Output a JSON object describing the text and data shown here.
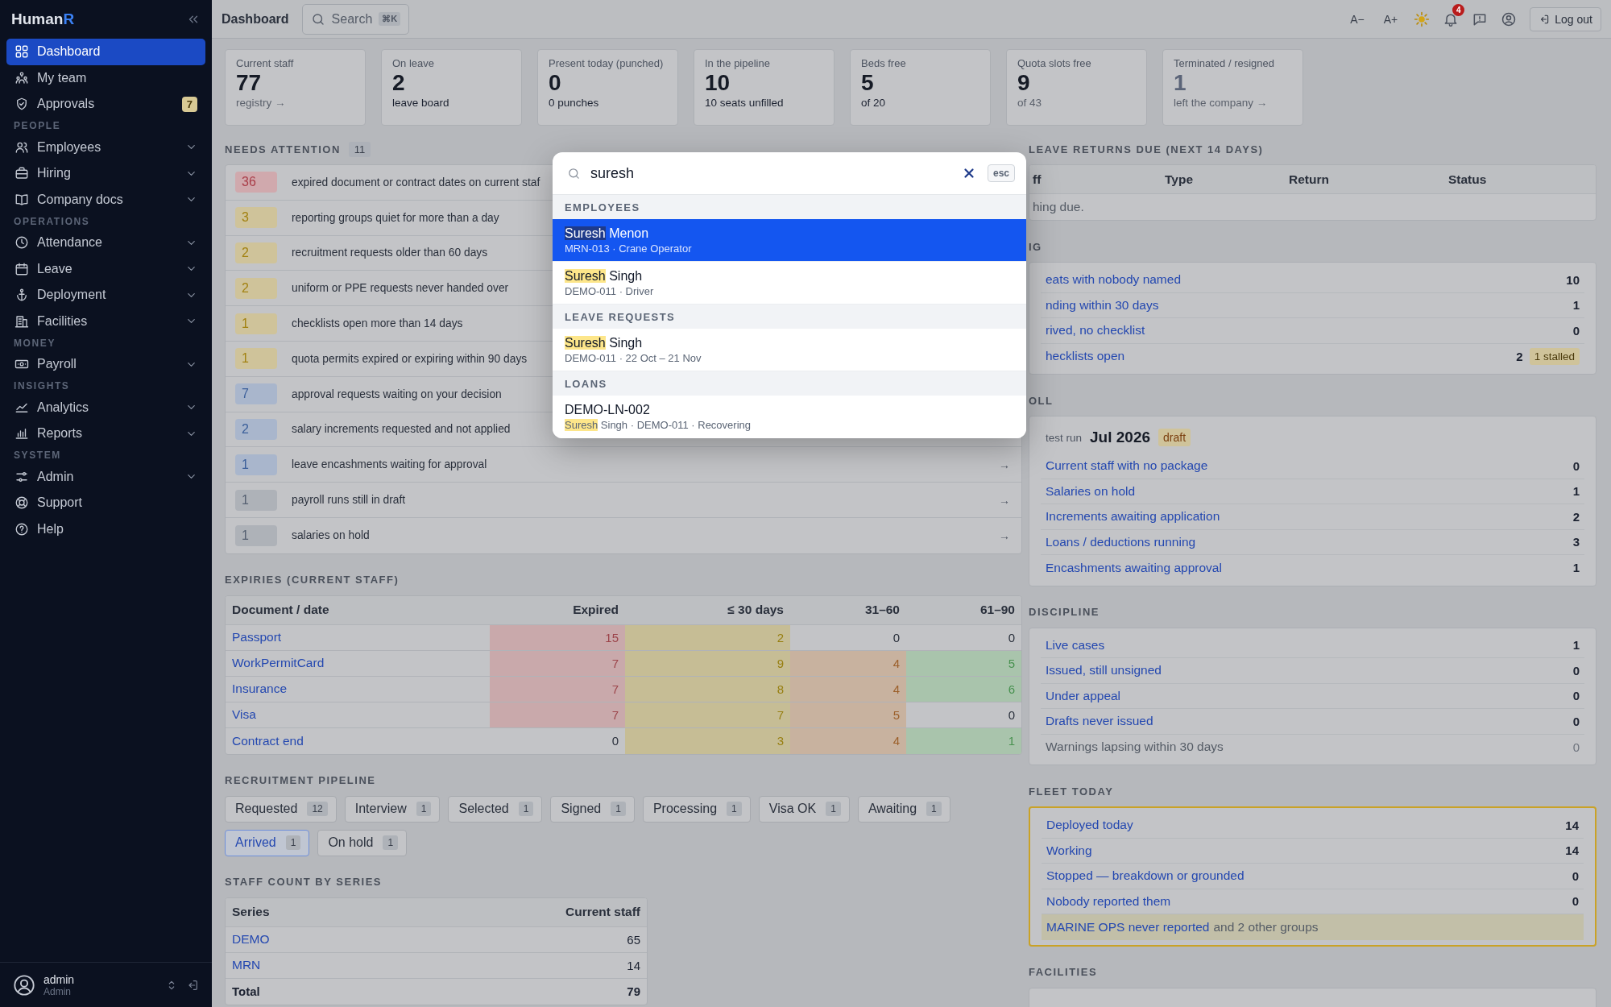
{
  "sidebar": {
    "logo": {
      "text": "Human",
      "accent": "R"
    },
    "sections": [
      {
        "items": [
          {
            "label": "Dashboard",
            "selected": true,
            "expandable": false
          },
          {
            "label": "My team",
            "selected": false,
            "expandable": false
          },
          {
            "label": "Approvals",
            "selected": false,
            "expandable": false,
            "badge": "7"
          }
        ]
      },
      {
        "label": "PEOPLE",
        "items": [
          {
            "label": "Employees",
            "selected": false,
            "expandable": true
          },
          {
            "label": "Hiring",
            "selected": false,
            "expandable": true
          },
          {
            "label": "Company docs",
            "selected": false,
            "expandable": true
          }
        ]
      },
      {
        "label": "OPERATIONS",
        "items": [
          {
            "label": "Attendance",
            "selected": false,
            "expandable": true
          },
          {
            "label": "Leave",
            "selected": false,
            "expandable": true
          },
          {
            "label": "Deployment",
            "selected": false,
            "expandable": true
          },
          {
            "label": "Facilities",
            "selected": false,
            "expandable": true
          }
        ]
      },
      {
        "label": "MONEY",
        "items": [
          {
            "label": "Payroll",
            "selected": false,
            "expandable": true
          }
        ]
      },
      {
        "label": "INSIGHTS",
        "items": [
          {
            "label": "Analytics",
            "selected": false,
            "expandable": true
          },
          {
            "label": "Reports",
            "selected": false,
            "expandable": true
          }
        ]
      },
      {
        "label": "SYSTEM",
        "items": [
          {
            "label": "Admin",
            "selected": false,
            "expandable": true
          },
          {
            "label": "Support",
            "selected": false,
            "expandable": false
          },
          {
            "label": "Help",
            "selected": false,
            "expandable": false
          }
        ]
      }
    ],
    "user": {
      "name": "admin",
      "role": "Admin"
    }
  },
  "topbar": {
    "title": "Dashboard",
    "search": {
      "label": "Search",
      "shortcut": "⌘K"
    },
    "font_smaller": "A−",
    "font_larger": "A+",
    "notifications": "4",
    "logout": "Log out"
  },
  "stats": [
    {
      "label": "Current staff",
      "value": "77",
      "sub": "registry →",
      "value_muted": false,
      "sub_muted": true
    },
    {
      "label": "On leave",
      "value": "2",
      "sub": "leave board",
      "value_muted": false,
      "sub_muted": false
    },
    {
      "label": "Present today (punched)",
      "value": "0",
      "sub": "0 punches",
      "value_muted": false,
      "sub_muted": false
    },
    {
      "label": "In the pipeline",
      "value": "10",
      "sub": "10 seats unfilled",
      "value_muted": false,
      "sub_muted": false
    },
    {
      "label": "Beds free",
      "value": "5",
      "sub": "of 20",
      "value_muted": false,
      "sub_muted": false
    },
    {
      "label": "Quota slots free",
      "value": "9",
      "sub": "of 43",
      "value_muted": false,
      "sub_muted": true
    },
    {
      "label": "Terminated / resigned",
      "value": "1",
      "sub": "left the company →",
      "value_muted": true,
      "sub_muted": true
    }
  ],
  "needs_attention": {
    "title": "NEEDS ATTENTION",
    "count": "11",
    "rows": [
      {
        "count": "36",
        "color": "#d0a9ad",
        "text": "expired document or contract dates on current staf"
      },
      {
        "count": "3",
        "color": "#cfc39a",
        "text": "reporting groups quiet for more than a day"
      },
      {
        "count": "2",
        "color": "#cfc39a",
        "text": "recruitment requests older than 60 days"
      },
      {
        "count": "2",
        "color": "#cfc39a",
        "text": "uniform or PPE requests never handed over"
      },
      {
        "count": "1",
        "color": "#cfc39a",
        "text": "checklists open more than 14 days"
      },
      {
        "count": "1",
        "color": "#cfc39a",
        "text": "quota permits expired or expiring within 90 days"
      },
      {
        "count": "7",
        "color": "#a9b6cc",
        "text": "approval requests waiting on your decision"
      },
      {
        "count": "2",
        "color": "#a9b6cc",
        "text": "salary increments requested and not applied"
      },
      {
        "count": "1",
        "color": "#a9b6cc",
        "text": "leave encashments waiting for approval",
        "arrow": "→"
      },
      {
        "count": "1",
        "color": "#aeb2b8",
        "text": "payroll runs still in draft",
        "arrow": "→"
      },
      {
        "count": "1",
        "color": "#aeb2b8",
        "text": "salaries on hold",
        "arrow": "→"
      }
    ]
  },
  "expiries": {
    "title": "EXPIRIES (CURRENT STAFF)",
    "columns": [
      "Document / date",
      "Expired",
      "≤ 30 days",
      "31–60",
      "61–90"
    ],
    "rows": [
      {
        "cells": [
          {
            "value": "Passport"
          },
          {
            "value": "15",
            "color": "#c9a9ab"
          },
          {
            "value": "2",
            "color": "#c6bd95"
          },
          {
            "value": "0"
          },
          {
            "value": "0"
          }
        ]
      },
      {
        "cells": [
          {
            "value": "WorkPermitCard"
          },
          {
            "value": "7",
            "color": "#c9a9ab"
          },
          {
            "value": "9",
            "color": "#c6bd95"
          },
          {
            "value": "4",
            "color": "#c8b29f"
          },
          {
            "value": "5",
            "color": "#a9c4ac"
          }
        ]
      },
      {
        "cells": [
          {
            "value": "Insurance"
          },
          {
            "value": "7",
            "color": "#c9a9ab"
          },
          {
            "value": "8",
            "color": "#c6bd95"
          },
          {
            "value": "4",
            "color": "#c8b29f"
          },
          {
            "value": "6",
            "color": "#a9c4ac"
          }
        ]
      },
      {
        "cells": [
          {
            "value": "Visa"
          },
          {
            "value": "7",
            "color": "#c9a9ab"
          },
          {
            "value": "7",
            "color": "#c6bd95"
          },
          {
            "value": "5",
            "color": "#c8b29f"
          },
          {
            "value": "0"
          }
        ]
      },
      {
        "cells": [
          {
            "value": "Contract end"
          },
          {
            "value": "0"
          },
          {
            "value": "3",
            "color": "#c6bd95"
          },
          {
            "value": "4",
            "color": "#c8b29f"
          },
          {
            "value": "1",
            "color": "#a9c4ac"
          }
        ]
      }
    ]
  },
  "pipeline": {
    "title": "RECRUITMENT PIPELINE",
    "stages": [
      {
        "label": "Requested",
        "count": "12",
        "selected": false
      },
      {
        "label": "Interview",
        "count": "1",
        "selected": false
      },
      {
        "label": "Selected",
        "count": "1",
        "selected": false
      },
      {
        "label": "Signed",
        "count": "1",
        "selected": false
      },
      {
        "label": "Processing",
        "count": "1",
        "selected": false
      },
      {
        "label": "Visa OK",
        "count": "1",
        "selected": false
      },
      {
        "label": "Awaiting",
        "count": "1",
        "selected": false
      },
      {
        "label": "Arrived",
        "count": "1",
        "selected": true
      },
      {
        "label": "On hold",
        "count": "1",
        "selected": false
      }
    ]
  },
  "staff_by_series": {
    "title": "STAFF COUNT BY SERIES",
    "columns": [
      "Series",
      "Current staff"
    ],
    "rows": [
      {
        "name": "DEMO",
        "value": "65"
      },
      {
        "name": "MRN",
        "value": "14"
      }
    ],
    "total": {
      "label": "Total",
      "value": "79"
    }
  },
  "leave_returns": {
    "title": "LEAVE RETURNS DUE (NEXT 14 DAYS)",
    "columns": [
      "ff",
      "Type",
      "Return",
      "Status"
    ],
    "empty": "hing due."
  },
  "hiring": {
    "title": "IG",
    "rows": [
      {
        "label": "eats with nobody named",
        "value": "10",
        "muted": false
      },
      {
        "label": "nding within 30 days",
        "value": "1",
        "muted": false
      },
      {
        "label": "rived, no checklist",
        "value": "0",
        "muted": false
      },
      {
        "label": "hecklists open",
        "value": "2",
        "muted": false,
        "tag": "1 stalled"
      }
    ]
  },
  "payroll": {
    "title": "OLL",
    "latest_label": "test run",
    "latest_value": "Jul 2026",
    "latest_tag": "draft",
    "rows": [
      {
        "label": "Current staff with no package",
        "value": "0",
        "muted": false
      },
      {
        "label": "Salaries on hold",
        "value": "1",
        "muted": false
      },
      {
        "label": "Increments awaiting application",
        "value": "2",
        "muted": false
      },
      {
        "label": "Loans / deductions running",
        "value": "3",
        "muted": false
      },
      {
        "label": "Encashments awaiting approval",
        "value": "1",
        "muted": false
      }
    ]
  },
  "discipline": {
    "title": "DISCIPLINE",
    "rows": [
      {
        "label": "Live cases",
        "value": "1",
        "muted": false
      },
      {
        "label": "Issued, still unsigned",
        "value": "0",
        "muted": false
      },
      {
        "label": "Under appeal",
        "value": "0",
        "muted": false
      },
      {
        "label": "Drafts never issued",
        "value": "0",
        "muted": false
      },
      {
        "label": "Warnings lapsing within 30 days",
        "value": "0",
        "muted": true
      }
    ]
  },
  "fleet": {
    "title": "FLEET TODAY",
    "alert": true,
    "rows": [
      {
        "label": "Deployed today",
        "value": "14",
        "muted": false
      },
      {
        "label": "Working",
        "value": "14",
        "muted": false
      },
      {
        "label": "Stopped — breakdown or grounded",
        "value": "0",
        "muted": false
      },
      {
        "label": "Nobody reported them",
        "value": "0",
        "muted": false
      }
    ],
    "note": {
      "link": "MARINE OPS never reported",
      "text": "and 2 other groups"
    }
  },
  "facilities": {
    "title": "FACILITIES"
  },
  "popup": {
    "query": "suresh",
    "esc": "esc",
    "groups": [
      {
        "title": "EMPLOYEES",
        "items": [
          {
            "selected": true,
            "title": [
              {
                "text": "Suresh",
                "match": true
              },
              {
                "text": "Menon",
                "match": false
              }
            ],
            "sub": [
              {
                "text": "MRN-013 · Crane Operator",
                "match": false
              }
            ]
          },
          {
            "selected": false,
            "title": [
              {
                "text": "Suresh",
                "match": true
              },
              {
                "text": "Singh",
                "match": false
              }
            ],
            "sub": [
              {
                "text": "DEMO-011 · Driver",
                "match": false
              }
            ]
          }
        ]
      },
      {
        "title": "LEAVE REQUESTS",
        "items": [
          {
            "selected": false,
            "title": [
              {
                "text": "Suresh",
                "match": true
              },
              {
                "text": "Singh",
                "match": false
              }
            ],
            "sub": [
              {
                "text": "DEMO-011 · 22 Oct – 21 Nov",
                "match": false
              }
            ]
          }
        ]
      },
      {
        "title": "LOANS",
        "items": [
          {
            "selected": false,
            "title": [
              {
                "text": "DEMO-LN-002",
                "match": false
              }
            ],
            "sub": [
              {
                "text": "Suresh",
                "match": true
              },
              {
                "text": "Singh · DEMO-011 · Recovering",
                "match": false
              }
            ]
          }
        ]
      }
    ]
  }
}
